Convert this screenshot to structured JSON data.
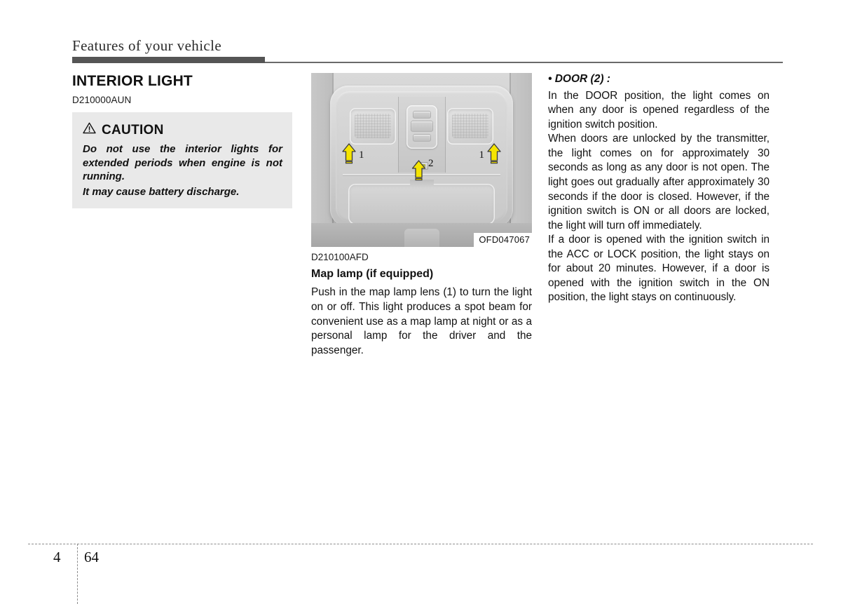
{
  "header": {
    "running_title": "Features of your vehicle"
  },
  "left_column": {
    "section_title": "INTERIOR LIGHT",
    "part_number": "D210000AUN",
    "caution": {
      "icon": "warning-triangle-icon",
      "label": "CAUTION",
      "lines": [
        "Do not use the interior lights for extended periods when engine is not running.",
        "It may cause battery discharge."
      ]
    }
  },
  "middle_column": {
    "figure": {
      "alt": "Overhead console with map lamps and sunroof switch",
      "caption": "OFD047067",
      "callouts": [
        {
          "number": "1",
          "position": "left-lamp"
        },
        {
          "number": "1",
          "position": "right-lamp"
        },
        {
          "number": "2",
          "position": "center-button"
        }
      ]
    },
    "part_number": "D210100AFD",
    "sub_title": "Map lamp (if equipped)",
    "paragraphs": [
      "Push in the map lamp lens (1) to turn the light on or off. This light produces a spot beam for convenient use as a map lamp at night or as a personal lamp for the driver and the passenger."
    ]
  },
  "right_column": {
    "bullet_heading": "• DOOR (2) :",
    "paragraphs": [
      "In the DOOR position, the light comes on when any door is opened regardless of the ignition switch position.",
      "When doors are unlocked by the transmitter, the light comes on for approximately 30 seconds as long as any door is not open. The light goes out gradually after approximately 30 seconds if the door is closed. However, if the ignition switch is ON or all doors are locked, the light will turn off immediately.",
      "If a door is opened with the ignition switch in the ACC or LOCK position, the light stays on for about 20 minutes. However, if a door is opened with the ignition switch in the ON position, the light stays on continuously."
    ]
  },
  "footer": {
    "chapter": "4",
    "page": "64"
  },
  "colors": {
    "header_rule": "#555555",
    "caution_background": "#e9e9e9",
    "callout_arrow": "#f5e400",
    "text": "#111111"
  }
}
